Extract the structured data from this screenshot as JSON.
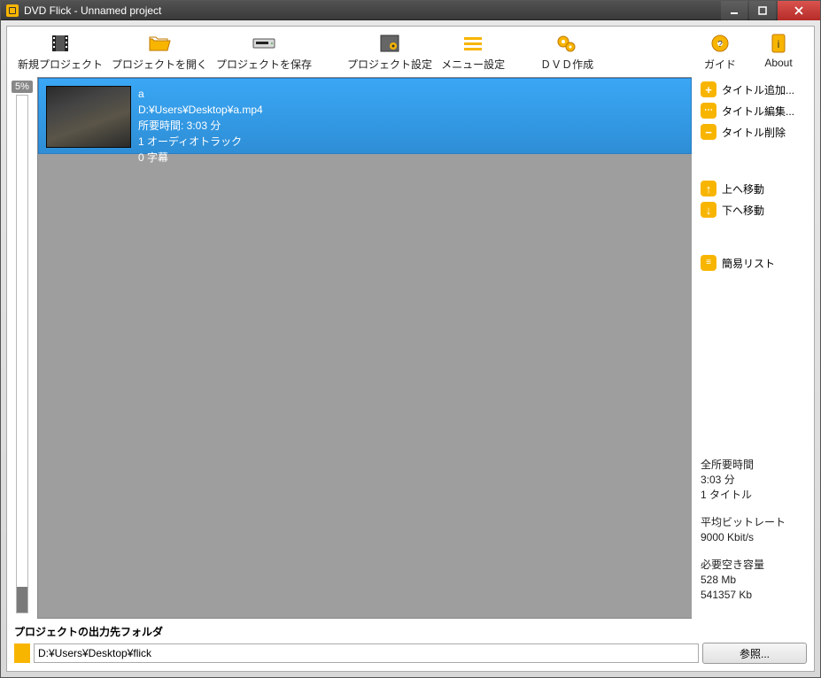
{
  "window": {
    "title": "DVD Flick - Unnamed project"
  },
  "toolbar": {
    "new_project": "新規プロジェクト",
    "open_project": "プロジェクトを開く",
    "save_project": "プロジェクトを保存",
    "project_settings": "プロジェクト設定",
    "menu_settings": "メニュー設定",
    "create_dvd": "ＤＶＤ作成",
    "guide": "ガイド",
    "about": "About"
  },
  "gauge": {
    "percent": "5%",
    "fill_percent": 5
  },
  "title_item": {
    "name": "a",
    "path": "D:¥Users¥Desktop¥a.mp4",
    "duration": "所要時間:  3:03 分",
    "audio": "1 オーディオトラック",
    "subs": "0 字幕"
  },
  "side": {
    "add": "タイトル追加...",
    "edit": "タイトル編集...",
    "remove": "タイトル削除",
    "up": "上へ移動",
    "down": "下へ移動",
    "simple": "簡易リスト"
  },
  "stats": {
    "total_label": "全所要時間",
    "total_value": "3:03 分",
    "titles": "1 タイトル",
    "bitrate_label": "平均ビットレート",
    "bitrate_value": "9000 Kbit/s",
    "space_label": "必要空き容量",
    "space_mb": "528 Mb",
    "space_kb": "541357 Kb"
  },
  "footer": {
    "label": "プロジェクトの出力先フォルダ",
    "path": "D:¥Users¥Desktop¥flick",
    "browse": "参照..."
  }
}
